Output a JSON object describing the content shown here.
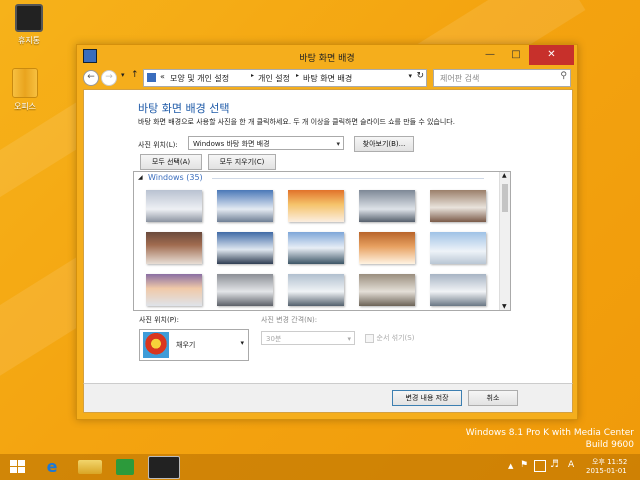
{
  "desktop": {
    "icons": [
      {
        "label": "휴지통"
      },
      {
        "label": "오피스"
      }
    ],
    "watermark": {
      "line1": "Windows 8.1 Pro K with Media Center",
      "line2": "Build 9600"
    }
  },
  "window": {
    "title": "바탕 화면 배경",
    "breadcrumb": [
      "모양 및 개인 설정",
      "개인 설정",
      "바탕 화면 배경"
    ],
    "breadcrumb_prefix": "«",
    "search_placeholder": "제어판 검색",
    "heading": "바탕 화면 배경 선택",
    "description": "바탕 화면 배경으로 사용할 사진을 한 개 클릭하세요. 두 개 이상을 클릭하면 슬라이드 쇼를 만들 수 있습니다.",
    "picture_location_label": "사진 위치(L):",
    "picture_location_value": "Windows 바탕 화면 배경",
    "browse_button": "찾아보기(B)...",
    "select_all_button": "모두 선택(A)",
    "clear_all_button": "모두 지우기(C)",
    "group_label": "Windows (35)",
    "position_label": "사진 위치(P):",
    "position_value": "채우기",
    "interval_label": "사진 변경 간격(N):",
    "interval_value": "30분",
    "shuffle_label": "순서 섞기(S)",
    "save_button": "변경 내용 저장",
    "cancel_button": "취소"
  },
  "colors": {
    "accent": "#f5ae1c",
    "heading_blue": "#1e5aa8",
    "group_blue": "#3a6dbd"
  },
  "taskbar": {
    "items": [
      "start-icon",
      "ie-icon",
      "explorer-icon",
      "store-icon",
      "control-panel-icon"
    ],
    "time": "오후 11:52",
    "date": "2015-01-01",
    "ime": "A"
  }
}
